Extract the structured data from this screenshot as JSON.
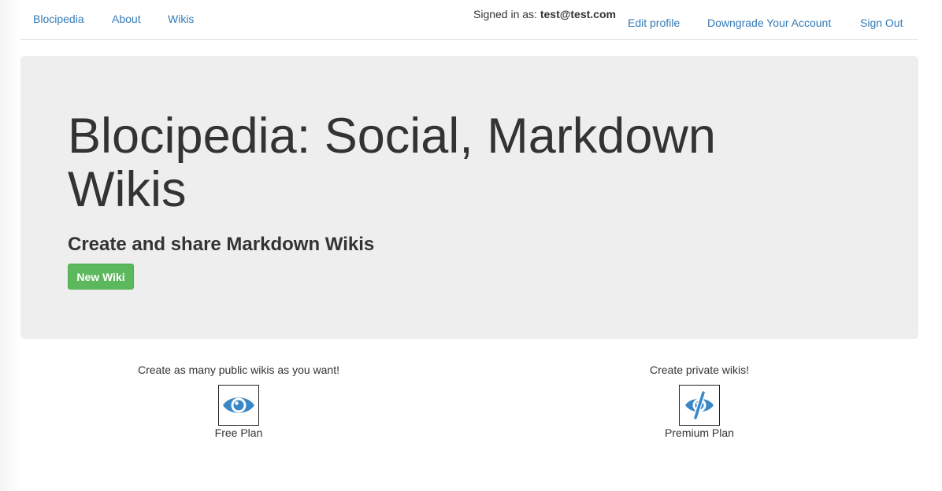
{
  "nav": {
    "brand": "Blocipedia",
    "about": "About",
    "wikis": "Wikis",
    "signed_in_prefix": "Signed in as:",
    "signed_in_user": "test@test.com",
    "edit_profile": "Edit profile",
    "downgrade": "Downgrade Your Account",
    "sign_out": "Sign Out"
  },
  "hero": {
    "title": "Blocipedia: Social, Markdown Wikis",
    "subtitle": "Create and share Markdown Wikis",
    "new_wiki_button": "New Wiki"
  },
  "plans": {
    "free": {
      "description": "Create as many public wikis as you want!",
      "icon": "eye-icon",
      "label": "Free Plan"
    },
    "premium": {
      "description": "Create private wikis!",
      "icon": "eye-slash-icon",
      "label": "Premium Plan"
    }
  },
  "colors": {
    "link": "#337ab7",
    "success": "#5cb85c",
    "jumbotron_bg": "#eeeeee",
    "icon_blue": "#3a87c8"
  }
}
